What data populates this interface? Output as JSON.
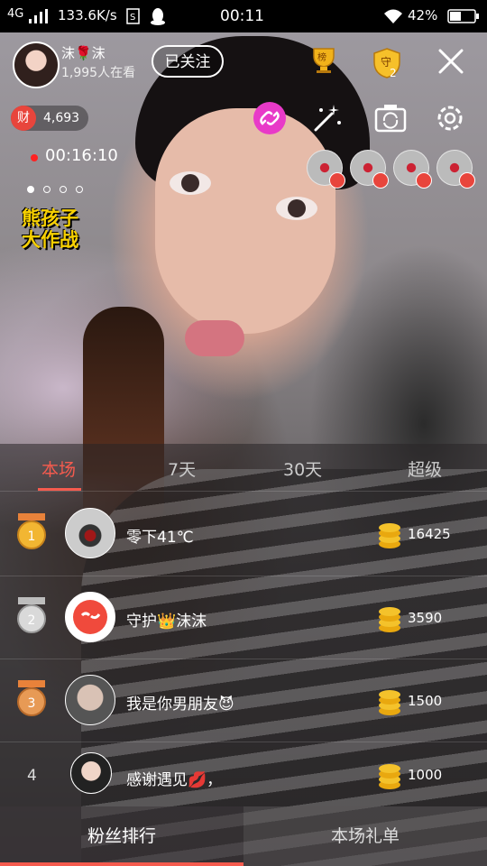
{
  "status_bar": {
    "network": "4G",
    "speed": "133.6K/s",
    "time": "00:11",
    "battery": "42%"
  },
  "host": {
    "name": "沫🌹沫",
    "viewers": "1,995人在看",
    "follow_label": "已关注",
    "rank_badge": "榜",
    "guard_badge": "守",
    "guard_count": "2"
  },
  "wealth": {
    "badge": "财",
    "value": "4,693"
  },
  "live_timer": "00:16:10",
  "promo": {
    "line1": "熊孩子",
    "line2": "大作战"
  },
  "ranking_tabs": [
    "本场",
    "7天",
    "30天",
    "超级"
  ],
  "ranking": [
    {
      "rank": "1",
      "name": "零下41℃",
      "coins": "16425"
    },
    {
      "rank": "2",
      "name": "守护👑沫沫",
      "coins": "3590"
    },
    {
      "rank": "3",
      "name": "我是你男朋友😈",
      "coins": "1500"
    },
    {
      "rank": "4",
      "name": "感谢遇见💋，",
      "coins": "1000"
    }
  ],
  "bottom_tabs": {
    "left": "粉丝排行",
    "right": "本场礼单"
  },
  "colors": {
    "accent": "#f55b4e",
    "wealth_badge": "#e8453c",
    "link_icon": "#e83ac8",
    "promo_text": "#f7d000"
  },
  "icons": [
    "signal-icon",
    "wifi-icon",
    "battery-icon",
    "trophy-icon",
    "shield-icon",
    "close-icon",
    "link-icon",
    "magic-wand-icon",
    "camera-switch-icon",
    "settings-icon",
    "coin-icon"
  ]
}
